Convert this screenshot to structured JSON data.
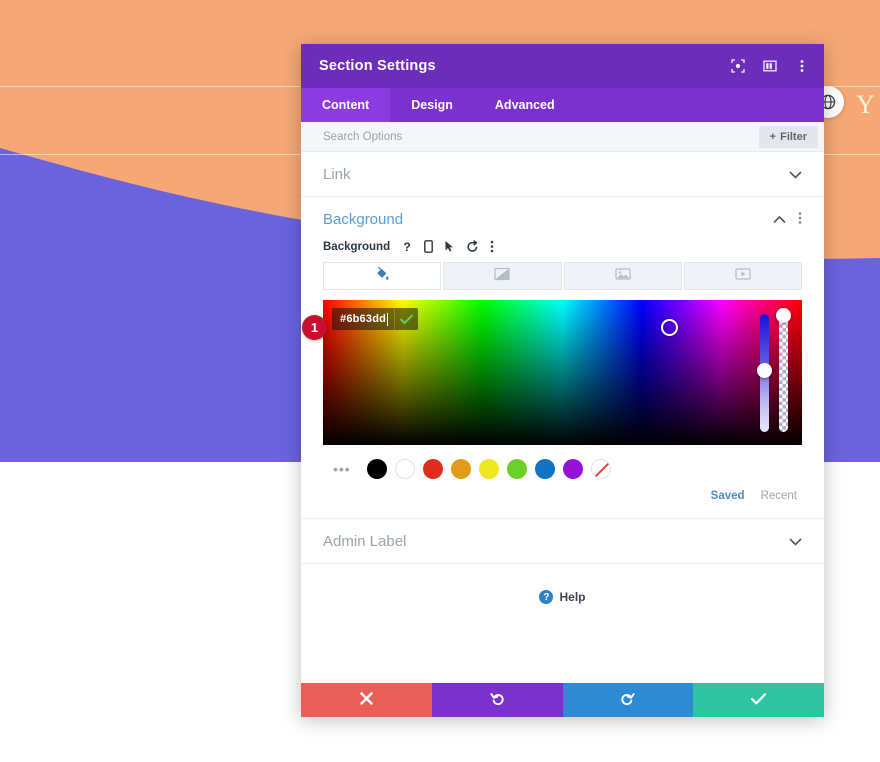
{
  "page_background": {
    "top_color": "#f5a875",
    "wave_color": "#6b63dd",
    "bottom_color": "#ffffff",
    "site_letter": "Y",
    "toggle_icon": "globe-icon"
  },
  "modal": {
    "title": "Section Settings",
    "header_icons": [
      {
        "name": "expand-icon",
        "glyph": "⬚"
      },
      {
        "name": "split-view-icon",
        "glyph": "▣"
      },
      {
        "name": "more-options-icon",
        "glyph": "⋮"
      }
    ],
    "tabs": [
      {
        "label": "Content",
        "active": true
      },
      {
        "label": "Design",
        "active": false
      },
      {
        "label": "Advanced",
        "active": false
      }
    ],
    "search": {
      "placeholder": "Search Options",
      "value": "",
      "filter_label": "Filter",
      "filter_icon": "plus-icon"
    },
    "accordions": [
      {
        "label": "Link",
        "expanded": false,
        "chevron": "chevron-down-icon"
      },
      {
        "label": "Admin Label",
        "expanded": false,
        "chevron": "chevron-down-icon"
      }
    ],
    "background_section": {
      "title": "Background",
      "collapse_icon": "chevron-up-icon",
      "more_icon": "more-options-icon",
      "field_label": "Background",
      "field_icons": [
        {
          "name": "help-icon",
          "glyph": "?"
        },
        {
          "name": "responsive-mobile-icon",
          "glyph": "▯"
        },
        {
          "name": "hover-cursor-icon",
          "glyph": "➤"
        },
        {
          "name": "reset-icon",
          "glyph": "↺"
        },
        {
          "name": "more-options-icon",
          "glyph": "⋮"
        }
      ],
      "bg_types": [
        {
          "name": "background-color-tab",
          "icon": "paint-bucket-icon",
          "active": true
        },
        {
          "name": "background-gradient-tab",
          "icon": "gradient-icon",
          "active": false
        },
        {
          "name": "background-image-tab",
          "icon": "image-icon",
          "active": false
        },
        {
          "name": "background-video-tab",
          "icon": "video-icon",
          "active": false
        }
      ],
      "color_picker": {
        "hex_value": "#6b63dd",
        "confirm_icon": "check-icon",
        "hue_slider_value": 247,
        "alpha_slider_value": 100,
        "saved_tab": "Saved",
        "recent_tab": "Recent",
        "more_swatches_icon": "ellipsis-icon",
        "swatches": [
          {
            "name": "swatch-black",
            "color": "#000000"
          },
          {
            "name": "swatch-white",
            "color": "#ffffff"
          },
          {
            "name": "swatch-red",
            "color": "#e02b20"
          },
          {
            "name": "swatch-orange",
            "color": "#e29b16"
          },
          {
            "name": "swatch-yellow",
            "color": "#f0e81f"
          },
          {
            "name": "swatch-green",
            "color": "#6fcf2a"
          },
          {
            "name": "swatch-blue",
            "color": "#1272c4"
          },
          {
            "name": "swatch-purple",
            "color": "#9512d8"
          },
          {
            "name": "swatch-transparent",
            "color": "none"
          }
        ]
      }
    },
    "help": {
      "label": "Help",
      "icon": "question-icon"
    },
    "footer_buttons": [
      {
        "name": "cancel-button",
        "icon": "close-icon",
        "glyph": "✖",
        "color": "#ea5e5a"
      },
      {
        "name": "undo-button",
        "icon": "undo-icon",
        "glyph": "↺",
        "color": "#7b31cd"
      },
      {
        "name": "redo-button",
        "icon": "redo-icon",
        "glyph": "↻",
        "color": "#2f8ad4"
      },
      {
        "name": "save-button",
        "icon": "check-icon",
        "glyph": "✔",
        "color": "#2ec4a0"
      }
    ]
  },
  "annotation": {
    "step_number": "1"
  }
}
